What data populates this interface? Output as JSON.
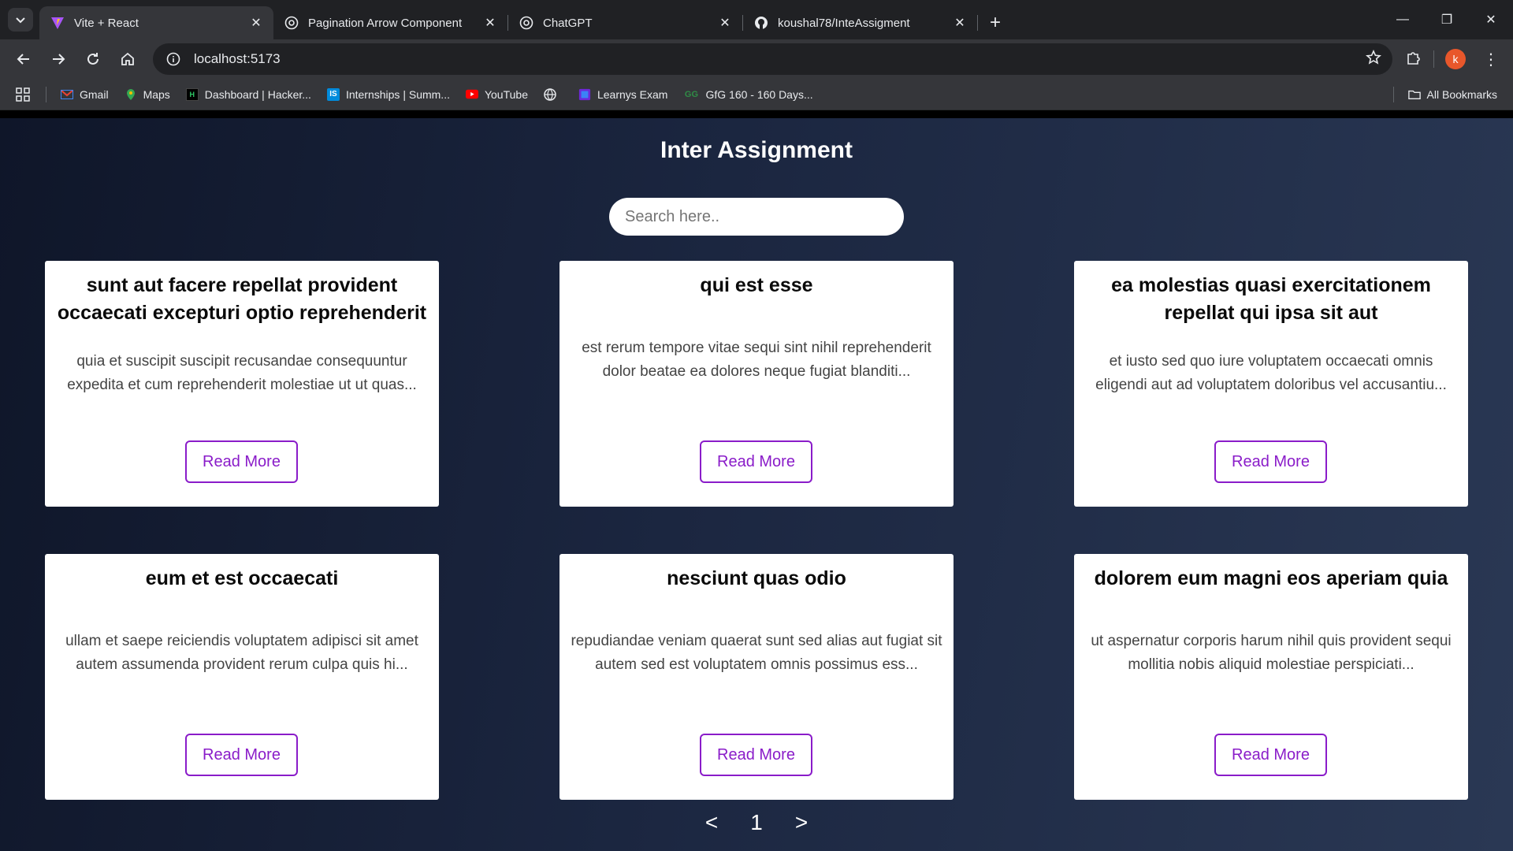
{
  "browser": {
    "tabs": [
      {
        "title": "Vite + React",
        "active": true,
        "icon": "vite-icon"
      },
      {
        "title": "Pagination Arrow Component",
        "active": false,
        "icon": "chatgpt-icon"
      },
      {
        "title": "ChatGPT",
        "active": false,
        "icon": "chatgpt-icon"
      },
      {
        "title": "koushal78/InteAssigment",
        "active": false,
        "icon": "github-icon"
      }
    ],
    "url": "localhost:5173",
    "profile_initial": "k",
    "bookmarks": [
      {
        "label": "Gmail",
        "icon": "gmail-icon"
      },
      {
        "label": "Maps",
        "icon": "maps-icon"
      },
      {
        "label": "Dashboard | Hacker...",
        "icon": "hackerrank-icon"
      },
      {
        "label": "Internships | Summ...",
        "icon": "internshala-icon"
      },
      {
        "label": "YouTube",
        "icon": "youtube-icon"
      },
      {
        "label": "",
        "icon": "globe-icon"
      },
      {
        "label": "Learnys Exam",
        "icon": "learnys-icon"
      },
      {
        "label": "GfG 160 - 160 Days...",
        "icon": "gfg-icon"
      }
    ],
    "all_bookmarks_label": "All Bookmarks"
  },
  "page": {
    "title": "Inter Assignment",
    "search_placeholder": "Search here..",
    "read_more_label": "Read More",
    "cards": [
      {
        "title": "sunt aut facere repellat provident occaecati excepturi optio reprehenderit",
        "body": "quia et suscipit suscipit recusandae consequuntur expedita et cum reprehenderit molestiae ut ut quas..."
      },
      {
        "title": "qui est esse",
        "body": "est rerum tempore vitae sequi sint nihil reprehenderit dolor beatae ea dolores neque fugiat blanditi..."
      },
      {
        "title": "ea molestias quasi exercitationem repellat qui ipsa sit aut",
        "body": "et iusto sed quo iure voluptatem occaecati omnis eligendi aut ad voluptatem doloribus vel accusantiu..."
      },
      {
        "title": "eum et est occaecati",
        "body": "ullam et saepe reiciendis voluptatem adipisci sit amet autem assumenda provident rerum culpa quis hi..."
      },
      {
        "title": "nesciunt quas odio",
        "body": "repudiandae veniam quaerat sunt sed alias aut fugiat sit autem sed est voluptatem omnis possimus ess..."
      },
      {
        "title": "dolorem eum magni eos aperiam quia",
        "body": "ut aspernatur corporis harum nihil quis provident sequi mollitia nobis aliquid molestiae perspiciati..."
      }
    ],
    "pagination": {
      "prev": "<",
      "current": "1",
      "next": ">"
    }
  },
  "colors": {
    "accent": "#8a1cc9",
    "card_bg": "#ffffff",
    "page_bg": "#1b2640"
  }
}
